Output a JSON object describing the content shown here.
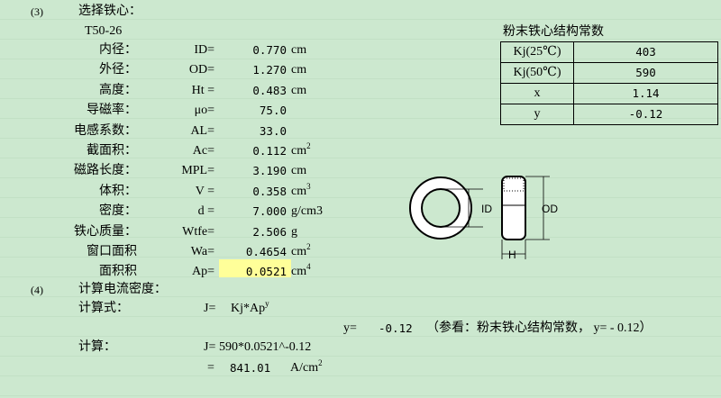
{
  "section3": {
    "num": "(3)",
    "title": "选择铁心：",
    "core": "T50-26"
  },
  "params": [
    {
      "name": "内径：",
      "sym": "ID=",
      "val": "0.770",
      "unit": "cm",
      "sup": ""
    },
    {
      "name": "外径：",
      "sym": "OD=",
      "val": "1.270",
      "unit": "cm",
      "sup": ""
    },
    {
      "name": "高度：",
      "sym": "Ht =",
      "val": "0.483",
      "unit": "cm",
      "sup": ""
    },
    {
      "name": "导磁率：",
      "sym": "μo=",
      "val": "75.0",
      "unit": "",
      "sup": ""
    },
    {
      "name": "电感系数：",
      "sym": "AL=",
      "val": "33.0",
      "unit": "",
      "sup": ""
    },
    {
      "name": "截面积：",
      "sym": "Ac=",
      "val": "0.112",
      "unit": "cm",
      "sup": "2"
    },
    {
      "name": "磁路长度：",
      "sym": "MPL=",
      "val": "3.190",
      "unit": "cm",
      "sup": ""
    },
    {
      "name": "体积：",
      "sym": "V =",
      "val": "0.358",
      "unit": "cm",
      "sup": "3"
    },
    {
      "name": "密度：",
      "sym": "d =",
      "val": "7.000",
      "unit": "g/cm3",
      "sup": ""
    },
    {
      "name": "铁心质量：",
      "sym": "Wtfe=",
      "val": "2.506",
      "unit": "g",
      "sup": ""
    },
    {
      "name": "窗口面积",
      "sym": "Wa=",
      "val": "0.4654",
      "unit": "cm",
      "sup": "2"
    },
    {
      "name": "面积积",
      "sym": "Ap=",
      "val": "0.0521",
      "unit": "cm",
      "sup": "4"
    }
  ],
  "kj_table": {
    "title": "粉末铁心结构常数",
    "rows": [
      {
        "k": "Kj(25℃)",
        "v": "403"
      },
      {
        "k": "Kj(50℃)",
        "v": "590"
      },
      {
        "k": "x",
        "v": "1.14"
      },
      {
        "k": "y",
        "v": "-0.12"
      }
    ]
  },
  "diagram": {
    "id_label": "ID",
    "od_label": "OD",
    "h_label": "H"
  },
  "section4": {
    "num": "(4)",
    "title": "计算电流密度：",
    "formula_label": "计算式：",
    "formula_sym": "J=",
    "formula": "Kj*Ap",
    "formula_sup": "y",
    "y_label": "y=",
    "y_value": "-0.12",
    "note": "（参看：粉末铁心结构常数， y= - 0.12）",
    "calc_label": "计算：",
    "calc_sym": "J=",
    "calc_expr": "590*0.0521^-0.12",
    "eq": "=",
    "result": "841.01",
    "result_unit": "A/cm",
    "result_sup": "2"
  },
  "colors": {
    "background": "#cce8cf",
    "highlight": "#ffff99"
  }
}
